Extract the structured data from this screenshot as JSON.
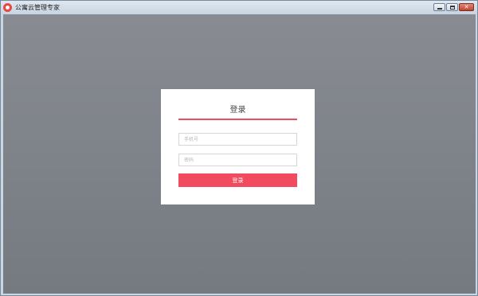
{
  "window": {
    "title": "公寓云管理专家",
    "icon": "app-logo-icon",
    "controls": {
      "minimize_icon": "minimize-icon",
      "maximize_icon": "maximize-icon",
      "close_icon": "close-icon",
      "close_glyph": "✕"
    }
  },
  "login": {
    "title": "登录",
    "phone_placeholder": "手机号",
    "password_placeholder": "密码",
    "phone_value": "",
    "password_value": "",
    "submit_label": "登录"
  },
  "colors": {
    "accent": "#f24a5e",
    "background_top": "#888b92",
    "background_bottom": "#757a81",
    "card": "#ffffff"
  }
}
